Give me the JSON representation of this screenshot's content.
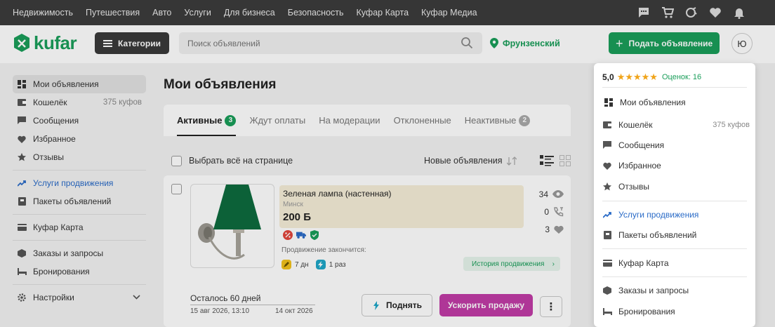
{
  "topnav": {
    "links": [
      "Недвижимость",
      "Путешествия",
      "Авто",
      "Услуги",
      "Для бизнеса",
      "Безопасность",
      "Куфар Карта",
      "Куфар Медиа"
    ],
    "icons": [
      "chat-icon",
      "cart-icon",
      "compare-icon",
      "heart-icon",
      "bell-icon"
    ]
  },
  "header": {
    "logo": "kufar",
    "categories_label": "Категории",
    "search_placeholder": "Поиск объявлений",
    "location": "Фрунзенский",
    "post_label": "Подать объявление",
    "avatar_letter": "Ю"
  },
  "left_sidebar": {
    "items": [
      {
        "label": "Мои объявления",
        "icon": "grid-icon",
        "active": true
      },
      {
        "label": "Кошелёк",
        "icon": "wallet-icon",
        "extra": "375 куфов"
      },
      {
        "label": "Сообщения",
        "icon": "message-icon"
      },
      {
        "label": "Избранное",
        "icon": "heart-icon"
      },
      {
        "label": "Отзывы",
        "icon": "star-icon"
      },
      {
        "label": "Услуги продвижения",
        "icon": "trend-icon"
      },
      {
        "label": "Пакеты объявлений",
        "icon": "package-icon"
      },
      {
        "label": "Куфар Карта",
        "icon": "card-icon"
      },
      {
        "label": "Заказы и запросы",
        "icon": "box-icon"
      },
      {
        "label": "Бронирования",
        "icon": "bed-icon"
      },
      {
        "label": "Настройки",
        "icon": "gear-icon"
      }
    ]
  },
  "main": {
    "title": "Мои объявления",
    "tabs": [
      {
        "label": "Активные",
        "badge": "3"
      },
      {
        "label": "Ждут оплаты"
      },
      {
        "label": "На модерации"
      },
      {
        "label": "Отклоненные"
      },
      {
        "label": "Неактивные",
        "badge": "2"
      }
    ],
    "select_all_label": "Выбрать всё на странице",
    "sort_label": "Новые объявления",
    "ad": {
      "title": "Зеленая лампа (настенная)",
      "city": "Минск",
      "price": "200 Б",
      "views": "34",
      "calls": "0",
      "favorites": "3",
      "promo_label": "Продвижение закончится:",
      "promo_days": "7 дн",
      "promo_times": "1 раз",
      "history_label": "История продвижения",
      "remaining": "Осталось 60 дней",
      "date_start": "15 авг 2026, 13:10",
      "date_end": "14 окт 2026",
      "raise_label": "Поднять",
      "boost_label": "Ускорить продажу",
      "more_label": "⋮"
    }
  },
  "dropdown": {
    "rating_score": "5,0",
    "stars": "★★★★★",
    "rating_count": "Оценок: 16",
    "items": [
      {
        "label": "Мои объявления",
        "icon": "grid-icon"
      },
      {
        "label": "Кошелёк",
        "icon": "wallet-icon",
        "extra": "375 куфов"
      },
      {
        "label": "Сообщения",
        "icon": "message-icon"
      },
      {
        "label": "Избранное",
        "icon": "heart-icon"
      },
      {
        "label": "Отзывы",
        "icon": "star-icon"
      },
      {
        "label": "Услуги продвижения",
        "icon": "trend-icon"
      },
      {
        "label": "Пакеты объявлений",
        "icon": "package-icon"
      },
      {
        "label": "Куфар Карта",
        "icon": "card-icon"
      },
      {
        "label": "Заказы и запросы",
        "icon": "box-icon"
      },
      {
        "label": "Бронирования",
        "icon": "bed-icon"
      }
    ]
  },
  "colors": {
    "brand_green": "#1a9e5a",
    "boost_purple": "#c13ca6",
    "link_blue": "#2a6bc7",
    "star_orange": "#f0a41a"
  }
}
